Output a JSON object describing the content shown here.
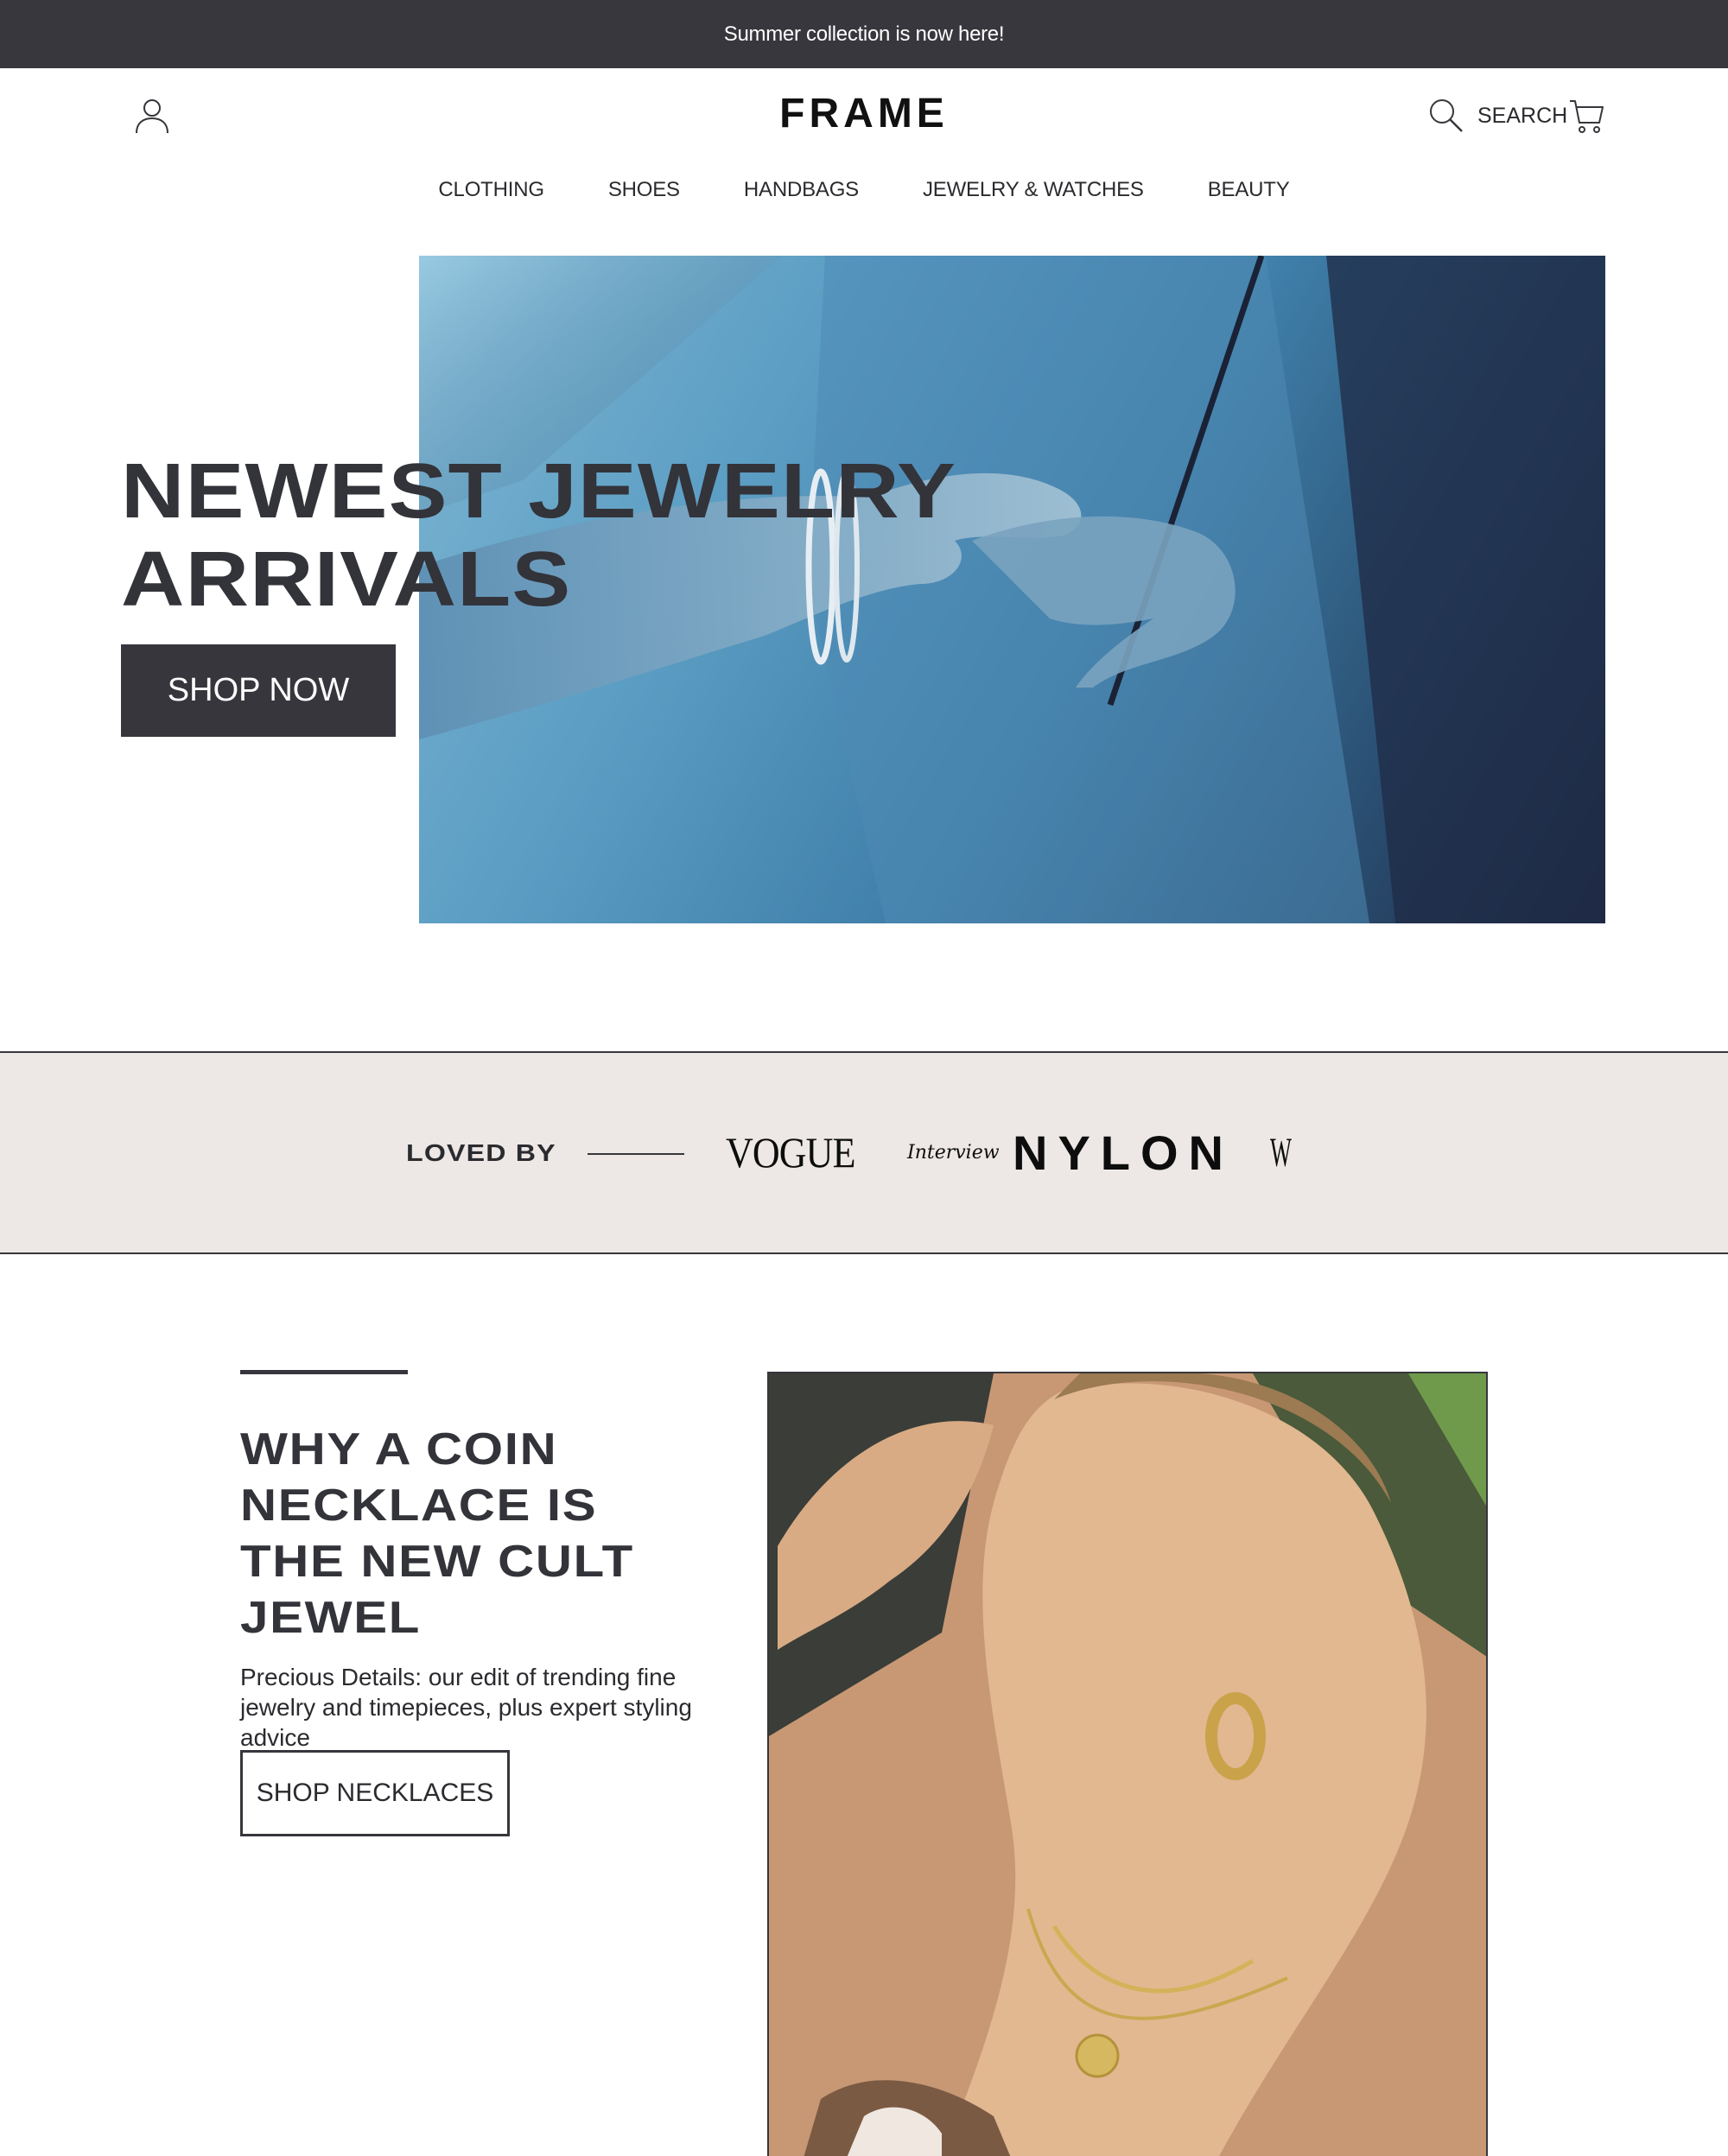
{
  "announcement": {
    "text": "Summer collection is now here!"
  },
  "header": {
    "logo": "FRAME",
    "search_label": "SEARCH",
    "icons": {
      "account": "user-icon",
      "search": "search-icon",
      "cart": "cart-icon"
    }
  },
  "nav": {
    "items": [
      {
        "label": "CLOTHING"
      },
      {
        "label": "SHOES"
      },
      {
        "label": "HANDBAGS"
      },
      {
        "label": "JEWELRY & WATCHES"
      },
      {
        "label": "BEAUTY"
      }
    ]
  },
  "hero": {
    "title_line1": "NEWEST JEWELRY",
    "title_line2": "ARRIVALS",
    "cta": "SHOP NOW"
  },
  "loved_by": {
    "label": "LOVED BY",
    "logos": [
      "VOGUE",
      "Interview",
      "NYLON",
      "W"
    ]
  },
  "feature": {
    "title": "WHY A COIN NECKLACE IS THE NEW CULT JEWEL",
    "description": "Precious Details: our edit of trending fine jewelry and timepieces, plus expert styling advice",
    "cta": "SHOP NECKLACES"
  },
  "colors": {
    "dark": "#36363c",
    "announcement_bg": "#38373d",
    "press_band_bg": "#ede8e5",
    "white": "#ffffff"
  }
}
